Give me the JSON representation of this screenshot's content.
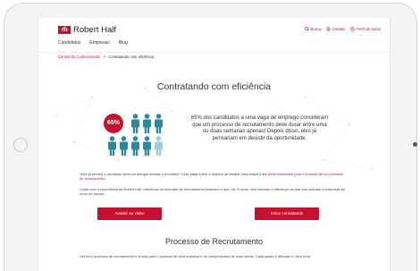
{
  "brand": {
    "logo_mark": "rh",
    "name": "Robert Half",
    "color": "#c8102e"
  },
  "utility": {
    "search": "Busca",
    "contact": "Contato",
    "profile": "Perfil de ponto"
  },
  "nav": [
    "Candidatos",
    "Empresas",
    "Blog"
  ],
  "breadcrumb": {
    "parent": "Central do Conhecimento",
    "separator": ">",
    "current": "Contratando com eficiência"
  },
  "hero": {
    "title": "Contratando com eficiência",
    "percent": "65%",
    "stat_text": "65% dos candidatos a uma vaga de emprego consideram que um processo de recrutamento deve durar entre uma ou duas semanas apenas! Depois disso, eles já pensariam em desistir da oportunidade.",
    "icons_highlighted": 7,
    "icons_total": 12
  },
  "body": {
    "para1_start": "Você já perdeu o candidato ideal por alongar demais o processo? Esse página tem o objetivo de facilitar essa etapa e dar ",
    "para1_link": "dicas essenciais para o sucesso de um processo de recrutamento.",
    "para2": "Conte com a experiência da Robert Half, referência no mercado de recrutamento brasileiro e que, há 70 anos, vem fazendo a diferença na vida das pessoas e empresas ao redor do mundo."
  },
  "buttons": {
    "video": "Assistir ao vídeo",
    "hiring": "Estou contratando"
  },
  "section2": {
    "title": "Processo de Recrutamento",
    "text": "Um bom processo de recrutamento é crucial para o sucesso de uma empresa e os cumprimentos de suas metas. Cada passo é delicado e, sem uma"
  }
}
